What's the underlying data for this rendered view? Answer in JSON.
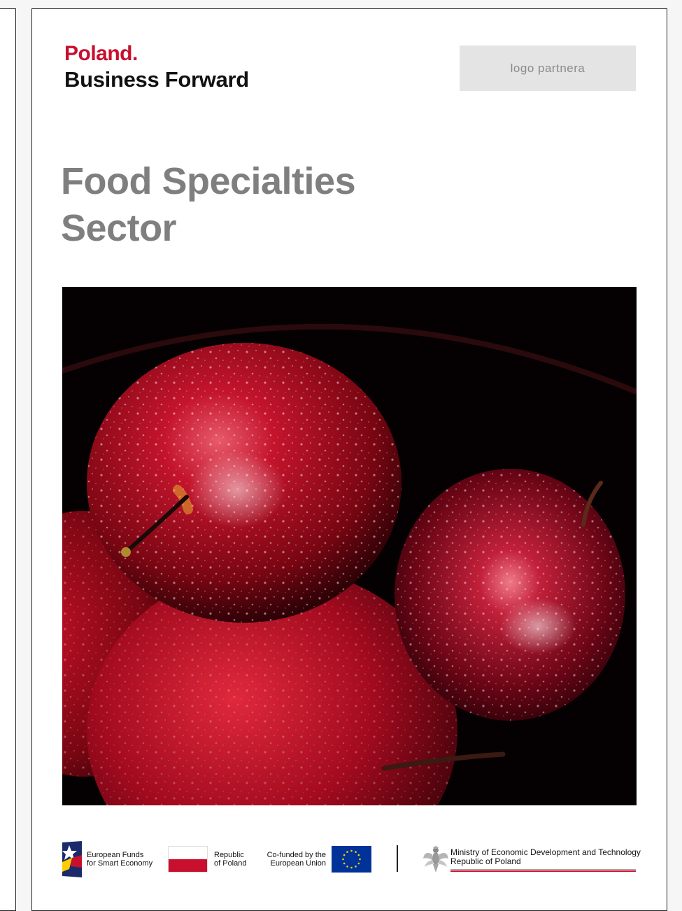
{
  "brand": {
    "line1": "Poland.",
    "line2": "Business Forward"
  },
  "partner_logo": {
    "label": "logo partnera"
  },
  "title": {
    "line1": "Food Specialties",
    "line2": "Sector"
  },
  "footer": {
    "funds": {
      "line1": "European Funds",
      "line2": "for Smart Economy"
    },
    "republic": {
      "line1": "Republic",
      "line2": "of Poland"
    },
    "eu": {
      "line1": "Co-funded by the",
      "line2": "European Union"
    },
    "ministry": {
      "line1": "Ministry of Economic Development and Technology",
      "line2": "Republic of Poland"
    }
  },
  "colors": {
    "accent": "#c8102e",
    "title_gray": "#7f7f7f",
    "eu_blue": "#003399",
    "eu_gold": "#ffcc00"
  }
}
